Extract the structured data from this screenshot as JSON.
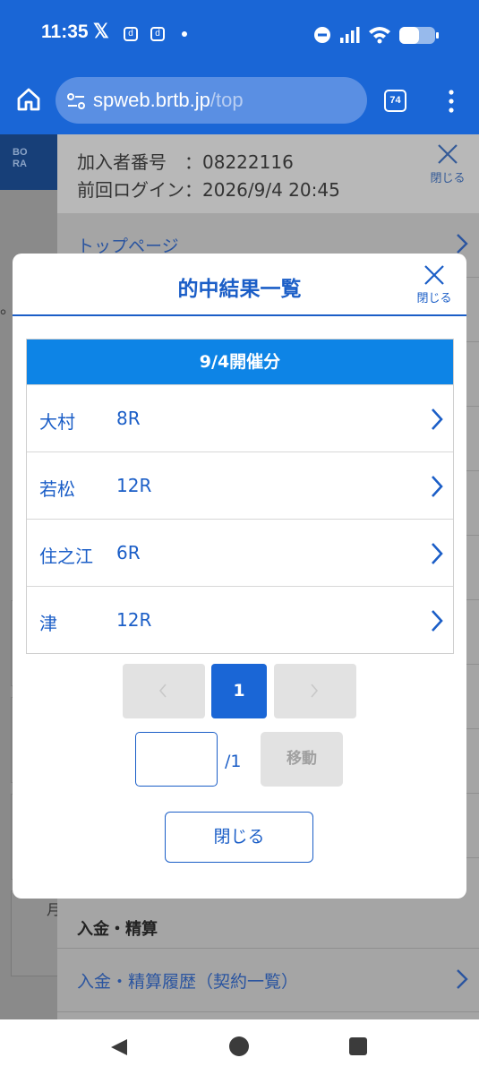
{
  "status_bar": {
    "time": "11:35",
    "x_app": "𝕏",
    "notif_icons": [
      "d",
      "d"
    ]
  },
  "browser": {
    "url_host": "spweb.brtb.jp",
    "url_path": "/top",
    "tab_count": "74"
  },
  "background": {
    "member_label": "加入者番号　：08222116",
    "last_login": "前回ログイン：2026/9/4 20:45",
    "close_label": "閉じる",
    "menu_top": "トップページ",
    "section_deposit": "入金・精算",
    "menu_deposit_history": "入金・精算履歴（契約一覧）",
    "logo_text": "BO\nRA",
    "side_fragment_1": "。",
    "side_fragment_2": "月"
  },
  "modal": {
    "title": "的中結果一覧",
    "close_label": "閉じる",
    "date_header": "9/4開催分",
    "rows": [
      {
        "venue": "大村",
        "race": "8R"
      },
      {
        "venue": "若松",
        "race": "12R"
      },
      {
        "venue": "住之江",
        "race": "6R"
      },
      {
        "venue": "津",
        "race": "12R"
      }
    ],
    "pager": {
      "prev": "‹",
      "current_page": "1",
      "next": "›"
    },
    "page_jump": {
      "input_value": "",
      "total": "/1",
      "move_label": "移動"
    },
    "close_button": "閉じる"
  },
  "colors": {
    "brand_blue": "#1a66d6",
    "header_blue": "#0d84e6",
    "text_blue": "#1b5ec7"
  }
}
